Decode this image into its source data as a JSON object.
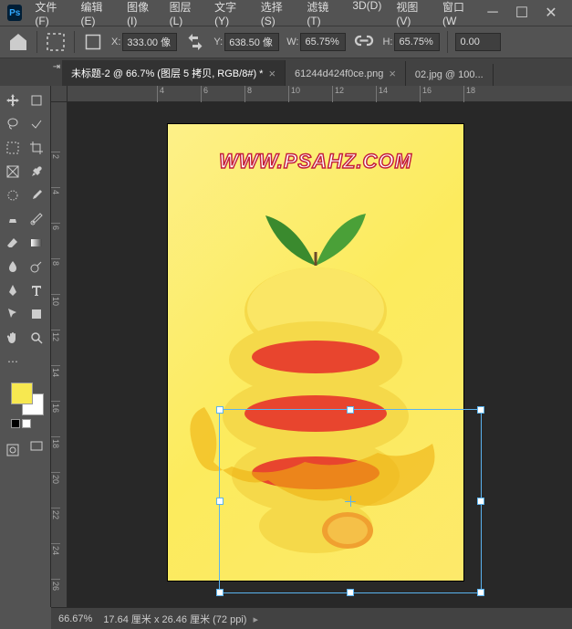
{
  "menu": {
    "items": [
      "文件(F)",
      "编辑(E)",
      "图像(I)",
      "图层(L)",
      "文字(Y)",
      "选择(S)",
      "滤镜(T)",
      "3D(D)",
      "视图(V)",
      "窗口(W"
    ]
  },
  "options": {
    "x_label": "X:",
    "x_value": "333.00 像",
    "y_label": "Y:",
    "y_value": "638.50 像",
    "w_label": "W:",
    "w_value": "65.75%",
    "h_label": "H:",
    "h_value": "65.75%",
    "angle_value": "0.00"
  },
  "tabs": [
    {
      "label": "未标题-2 @ 66.7% (图层 5 拷贝, RGB/8#) *",
      "active": true
    },
    {
      "label": "61244d424f0ce.png",
      "active": false
    },
    {
      "label": "02.jpg @ 100...",
      "active": false
    }
  ],
  "rulers": {
    "h": [
      "4",
      "6",
      "8",
      "10",
      "12",
      "14",
      "16",
      "18"
    ],
    "v": [
      "2",
      "4",
      "6",
      "8",
      "10",
      "12",
      "14",
      "16",
      "18",
      "20",
      "22",
      "24",
      "26"
    ]
  },
  "canvas": {
    "watermark": "WWW.PSAHZ.COM"
  },
  "status": {
    "zoom": "66.67%",
    "doc_info": "17.64 厘米 x 26.46 厘米 (72 ppi)"
  },
  "swatches": {
    "fg": "#f7e850",
    "bg": "#ffffff"
  }
}
